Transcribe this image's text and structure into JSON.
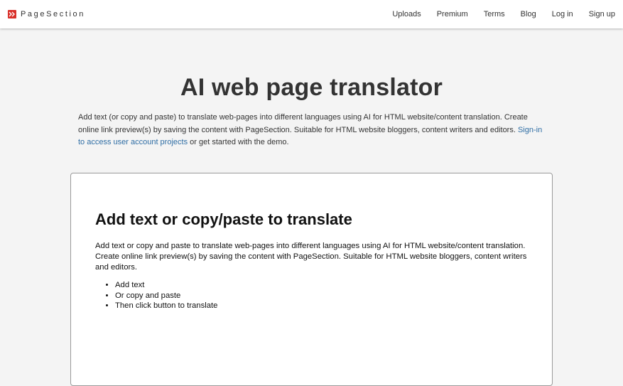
{
  "brand": {
    "name": "PageSection",
    "logo_color": "#d9302a"
  },
  "nav": {
    "items": [
      {
        "label": "Uploads"
      },
      {
        "label": "Premium"
      },
      {
        "label": "Terms"
      },
      {
        "label": "Blog"
      },
      {
        "label": "Log in"
      },
      {
        "label": "Sign up"
      }
    ]
  },
  "hero": {
    "title": "AI web page translator",
    "desc_before": "Add text (or copy and paste) to translate web-pages into different languages using AI for HTML website/content translation. Create online link preview(s) by saving the content with PageSection. Suitable for HTML website bloggers, content writers and editors. ",
    "desc_link": "Sign-in to access user account projects",
    "desc_after": " or get started with the demo."
  },
  "card": {
    "title": "Add text or copy/paste to translate",
    "description": "Add text or copy and paste to translate web-pages into different languages using AI for HTML website/content translation. Create online link preview(s) by saving the content with PageSection. Suitable for HTML website bloggers, content writers and editors.",
    "list": [
      "Add text",
      "Or copy and paste",
      "Then click button to translate"
    ]
  },
  "colors": {
    "link": "#2e6da4",
    "background": "#f4f4f4",
    "text": "#333333"
  }
}
